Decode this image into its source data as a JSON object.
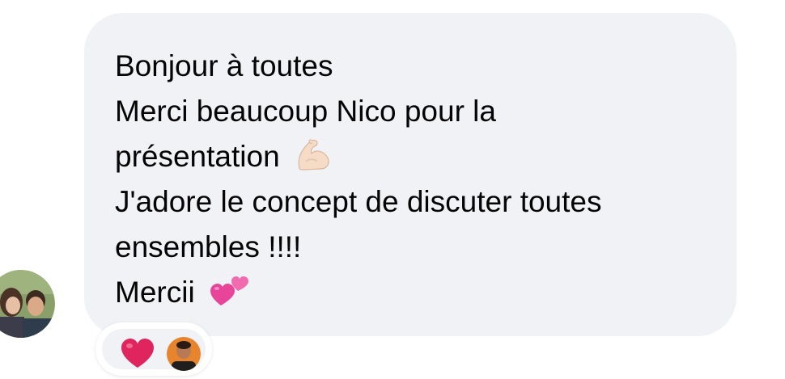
{
  "message": {
    "lines": [
      "Bonjour à toutes",
      "Merci beaucoup Nico pour la",
      "présentation",
      "J'adore le concept de discuter toutes",
      "ensembles !!!!",
      "Mercii"
    ],
    "line_emojis": {
      "2": "flexed-biceps",
      "5": "two-hearts"
    }
  },
  "reactions": [
    {
      "type": "heart",
      "icon": "red-heart-icon"
    },
    {
      "type": "avatar",
      "icon": "reactor-avatar"
    }
  ],
  "colors": {
    "bubble_bg": "#f0f2f5",
    "text": "#050505",
    "heart": "#e0245e"
  }
}
